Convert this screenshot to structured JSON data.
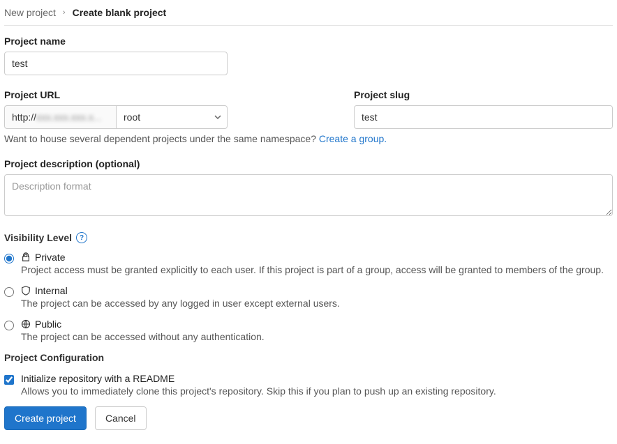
{
  "breadcrumb": {
    "parent": "New project",
    "current": "Create blank project"
  },
  "project_name": {
    "label": "Project name",
    "value": "test"
  },
  "project_url": {
    "label": "Project URL",
    "prefix_scheme": "http://",
    "prefix_host_masked": "xxx.xxx.xxx.x...",
    "namespace": "root"
  },
  "project_slug": {
    "label": "Project slug",
    "value": "test"
  },
  "namespace_hint": {
    "text": "Want to house several dependent projects under the same namespace? ",
    "link": "Create a group."
  },
  "description": {
    "label": "Project description (optional)",
    "placeholder": "Description format",
    "value": ""
  },
  "visibility": {
    "heading": "Visibility Level",
    "options": {
      "private": {
        "title": "Private",
        "desc": "Project access must be granted explicitly to each user. If this project is part of a group, access will be granted to members of the group.",
        "checked": true
      },
      "internal": {
        "title": "Internal",
        "desc": "The project can be accessed by any logged in user except external users.",
        "checked": false
      },
      "public": {
        "title": "Public",
        "desc": "The project can be accessed without any authentication.",
        "checked": false
      }
    }
  },
  "config": {
    "heading": "Project Configuration",
    "readme": {
      "label": "Initialize repository with a README",
      "desc": "Allows you to immediately clone this project's repository. Skip this if you plan to push up an existing repository.",
      "checked": true
    }
  },
  "buttons": {
    "submit": "Create project",
    "cancel": "Cancel"
  }
}
